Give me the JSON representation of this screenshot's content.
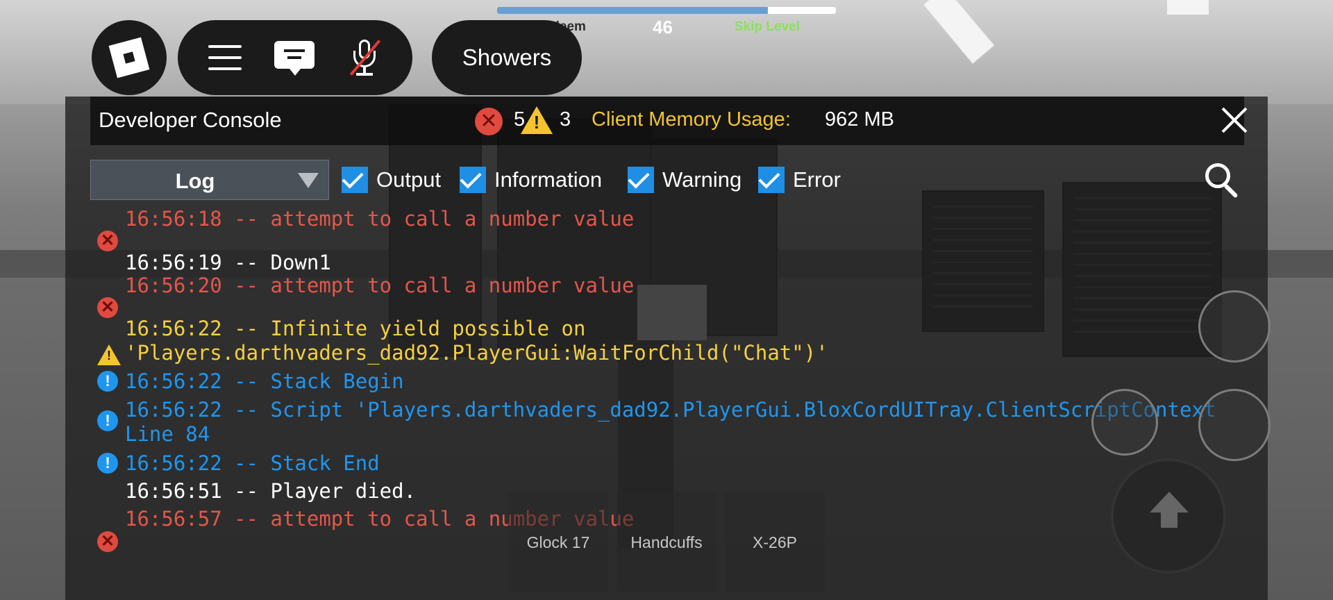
{
  "hud": {
    "location": "Showers",
    "progress": {
      "left_label": "Redeem",
      "value": "46",
      "right_label": "Skip Level",
      "fill_fraction": 0.8
    }
  },
  "console": {
    "title": "Developer Console",
    "error_count": "5",
    "warning_count": "3",
    "memory_label": "Client Memory Usage:",
    "memory_value": "962 MB",
    "tab": "Log",
    "filters": [
      {
        "label": "Output",
        "checked": true
      },
      {
        "label": "Information",
        "checked": true
      },
      {
        "label": "Warning",
        "checked": true
      },
      {
        "label": "Error",
        "checked": true
      }
    ],
    "logs": [
      {
        "type": "error",
        "text": "16:56:18 -- attempt to call a number value"
      },
      {
        "type": "output",
        "text": "16:56:19 -- Down1"
      },
      {
        "type": "error",
        "text": "16:56:20 -- attempt to call a number value"
      },
      {
        "type": "warning",
        "text": "16:56:22 -- Infinite yield possible on",
        "text2": "'Players.darthvaders_dad92.PlayerGui:WaitForChild(\"Chat\")'"
      },
      {
        "type": "info",
        "text": "16:56:22 -- Stack Begin"
      },
      {
        "type": "info",
        "text": "16:56:22 -- Script 'Players.darthvaders_dad92.PlayerGui.BloxCordUITray.ClientScriptContext",
        "text2": "Line 84"
      },
      {
        "type": "info",
        "text": "16:56:22 -- Stack End"
      },
      {
        "type": "output",
        "text": "16:56:51 -- Player died."
      },
      {
        "type": "error",
        "text": "16:56:57 -- attempt to call a number value"
      }
    ]
  },
  "hotbar": [
    "Glock 17",
    "Handcuffs",
    "X-26P"
  ],
  "colors": {
    "error": "#e5564b",
    "warning": "#f4d03f",
    "info": "#1e96f0",
    "checkbox": "#1f8fe5",
    "skip_level": "#8be05a"
  },
  "icons": [
    "roblox-logo-icon",
    "menu-icon",
    "chat-icon",
    "mic-muted-icon",
    "error-icon",
    "warning-icon",
    "close-icon",
    "search-icon",
    "info-icon",
    "jump-arrow-icon"
  ]
}
